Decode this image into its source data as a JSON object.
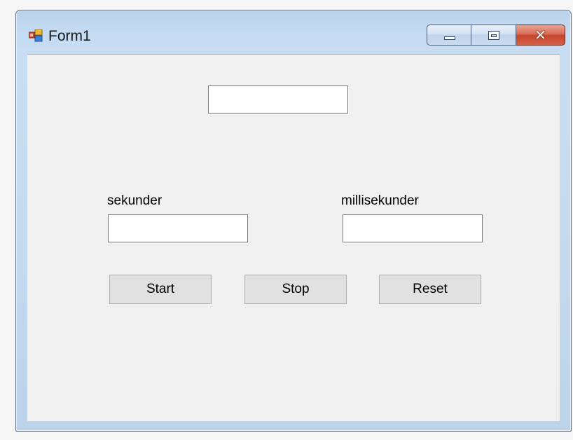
{
  "window": {
    "title": "Form1"
  },
  "form": {
    "display_value": "",
    "seconds_label": "sekunder",
    "seconds_value": "",
    "milliseconds_label": "millisekunder",
    "milliseconds_value": ""
  },
  "buttons": {
    "start_label": "Start",
    "stop_label": "Stop",
    "reset_label": "Reset"
  },
  "colors": {
    "client_background": "#f0f0f0",
    "button_face": "#e1e1e1",
    "close_button": "#c7452a"
  }
}
